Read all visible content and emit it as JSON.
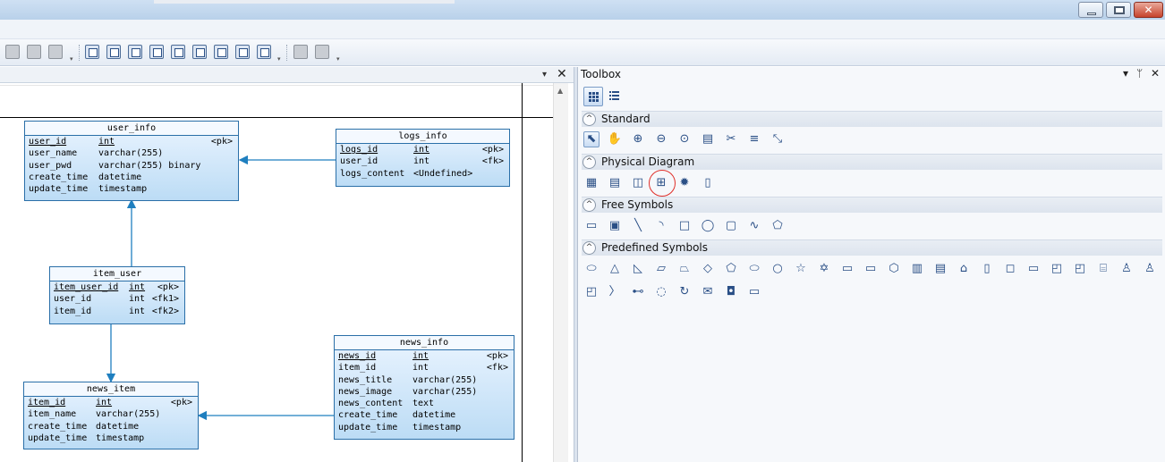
{
  "toolbox": {
    "title": "Toolbox",
    "pin_glyph": "▾",
    "pushpin_glyph": "ᛘ",
    "close_glyph": "✕",
    "sections": [
      {
        "label": "Standard",
        "toggle": "^"
      },
      {
        "label": "Physical Diagram",
        "toggle": "^"
      },
      {
        "label": "Free Symbols",
        "toggle": "^"
      },
      {
        "label": "Predefined Symbols",
        "toggle": "^"
      }
    ],
    "standard_icons": [
      "pointer-icon",
      "hand-icon",
      "zoom-in-icon",
      "zoom-out-icon",
      "zoom-fit-icon",
      "properties-icon",
      "cut-icon",
      "note-icon",
      "link-icon"
    ],
    "standard_glyphs": [
      "⬉",
      "✋",
      "⊕",
      "⊖",
      "⊙",
      "▤",
      "✂",
      "≡",
      "⤡"
    ],
    "physical_icons": [
      "package-icon",
      "table-icon",
      "view-icon",
      "reference-icon",
      "procedure-icon",
      "file-icon"
    ],
    "physical_glyphs": [
      "▦",
      "▤",
      "◫",
      "⊞",
      "✹",
      "▯"
    ],
    "free_glyphs": [
      "▭",
      "▣",
      "╲",
      "◝",
      "□",
      "◯",
      "▢",
      "∿",
      "⬠"
    ],
    "predefined_glyphs_row1": [
      "⬭",
      "△",
      "◺",
      "▱",
      "⏢",
      "◇",
      "⬠",
      "⬭",
      "○",
      "☆",
      "✡",
      "▭",
      "▭",
      "⬡",
      "▥",
      "▤",
      "⌂",
      "▯",
      "◻",
      "▭",
      "◰",
      "◰",
      "⌸",
      "♙",
      "♙"
    ],
    "predefined_glyphs_row2": [
      "◰",
      "〉",
      "⊷",
      "◌",
      "↻",
      "✉",
      "◘",
      "▭"
    ]
  },
  "diagram": {
    "close_glyph": "✕",
    "dropdown_glyph": "▾",
    "tables": [
      {
        "name": "user_info",
        "rows": [
          {
            "col": "user_id",
            "type": "int",
            "key": "<pk>",
            "underline": true
          },
          {
            "col": "user_name",
            "type": "varchar(255)",
            "key": "",
            "underline": false
          },
          {
            "col": "user_pwd",
            "type": "varchar(255) binary",
            "key": "",
            "underline": false
          },
          {
            "col": "create_time",
            "type": "datetime",
            "key": "",
            "underline": false
          },
          {
            "col": "update_time",
            "type": "timestamp",
            "key": "",
            "underline": false
          }
        ]
      },
      {
        "name": "logs_info",
        "rows": [
          {
            "col": "logs_id",
            "type": "int",
            "key": "<pk>",
            "underline": true
          },
          {
            "col": "user_id",
            "type": "int",
            "key": "<fk>",
            "underline": false
          },
          {
            "col": "logs_content",
            "type": "<Undefined>",
            "key": "",
            "underline": false
          }
        ]
      },
      {
        "name": "item_user",
        "rows": [
          {
            "col": "item_user_id",
            "type": "int",
            "key": "<pk>",
            "underline": true
          },
          {
            "col": "user_id",
            "type": "int",
            "key": "<fk1>",
            "underline": false
          },
          {
            "col": "item_id",
            "type": "int",
            "key": "<fk2>",
            "underline": false
          }
        ]
      },
      {
        "name": "news_info",
        "rows": [
          {
            "col": "news_id",
            "type": "int",
            "key": "<pk>",
            "underline": true
          },
          {
            "col": "item_id",
            "type": "int",
            "key": "<fk>",
            "underline": false
          },
          {
            "col": "news_title",
            "type": "varchar(255)",
            "key": "",
            "underline": false
          },
          {
            "col": "news_image",
            "type": "varchar(255)",
            "key": "",
            "underline": false
          },
          {
            "col": "news_content",
            "type": "text",
            "key": "",
            "underline": false
          },
          {
            "col": "create_time",
            "type": "datetime",
            "key": "",
            "underline": false
          },
          {
            "col": "update_time",
            "type": "timestamp",
            "key": "",
            "underline": false
          }
        ]
      },
      {
        "name": "news_item",
        "rows": [
          {
            "col": "item_id",
            "type": "int",
            "key": "<pk>",
            "underline": true
          },
          {
            "col": "item_name",
            "type": "varchar(255)",
            "key": "",
            "underline": false
          },
          {
            "col": "create_time",
            "type": "datetime",
            "key": "",
            "underline": false
          },
          {
            "col": "update_time",
            "type": "timestamp",
            "key": "",
            "underline": false
          }
        ]
      }
    ]
  },
  "colors": {
    "entity_border": "#2a6fa8",
    "link": "#1f7fbf",
    "highlight_circle": "#e0302a"
  }
}
